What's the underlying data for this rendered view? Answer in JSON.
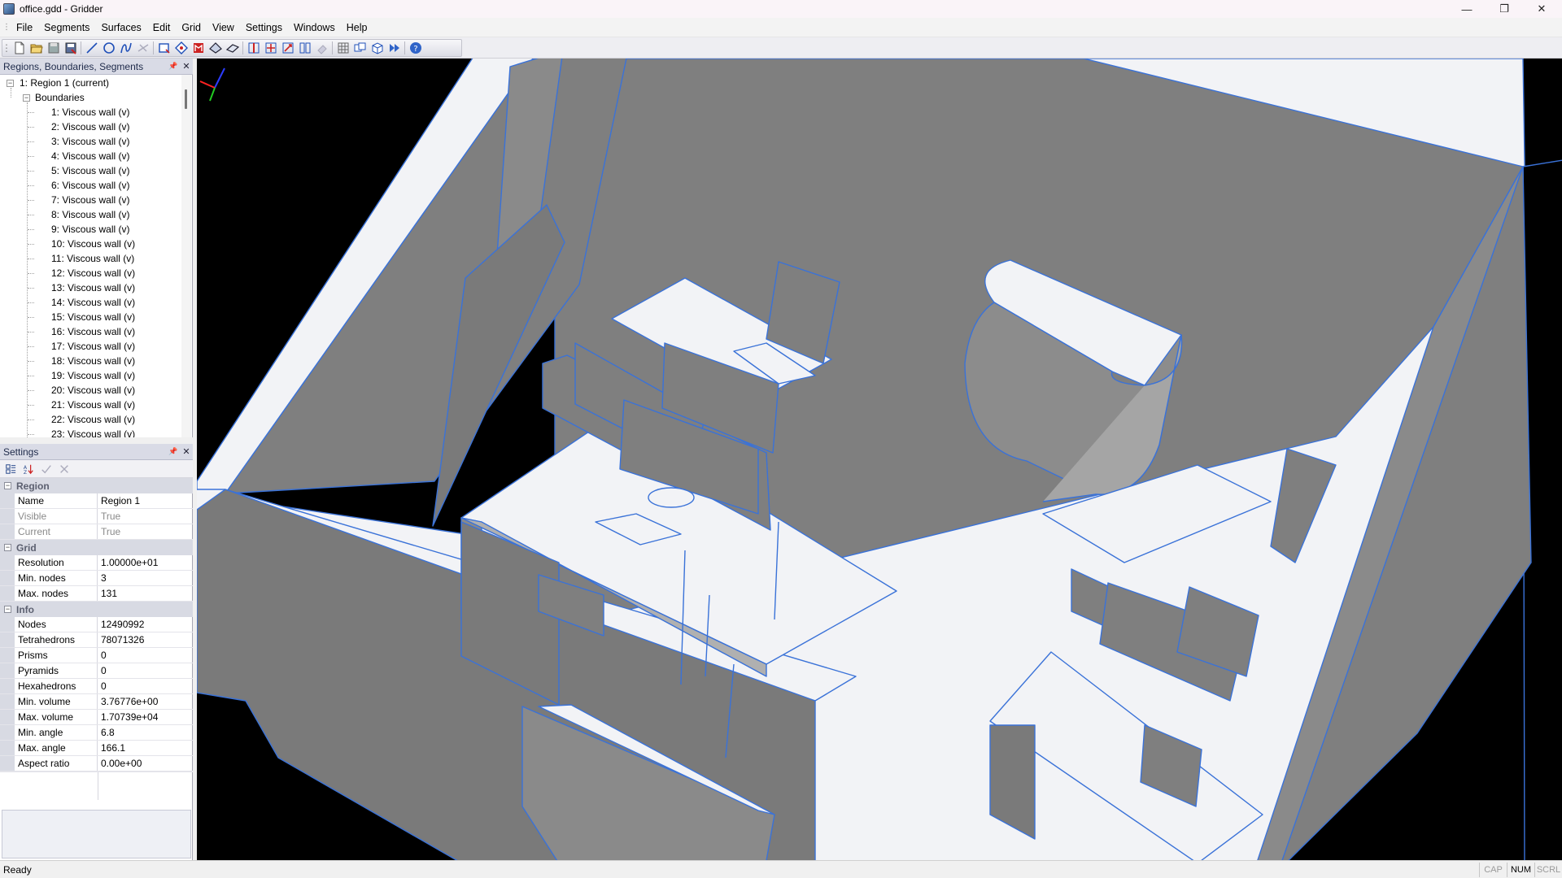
{
  "window": {
    "title": "office.gdd - Gridder",
    "minimize_glyph": "—",
    "restore_glyph": "❐",
    "close_glyph": "✕"
  },
  "menu": [
    "File",
    "Segments",
    "Surfaces",
    "Edit",
    "Grid",
    "View",
    "Settings",
    "Windows",
    "Help"
  ],
  "toolbar": {
    "icons": [
      "new-file-icon",
      "open-folder-icon",
      "save-icon",
      "save-as-icon",
      "line-segment-icon",
      "circle-segment-icon",
      "spline-segment-icon",
      "arc-disabled-icon",
      "create-surface-icon",
      "extrude-surface-icon",
      "revolve-surface-icon",
      "sweep-surface-icon",
      "loft-surface-icon",
      "split-icon",
      "move-icon",
      "scale-icon",
      "mirror-icon",
      "erase-disabled-icon",
      "generate-grid-icon",
      "grid-view-icon",
      "box-view-icon",
      "play-icon",
      "help-icon"
    ]
  },
  "tree_panel": {
    "title": "Regions, Boundaries, Segments",
    "pin_glyph": "📌",
    "close_glyph": "✕",
    "region": "1: Region 1 (current)",
    "boundaries_label": "Boundaries",
    "items": [
      "1: Viscous wall (v)",
      "2: Viscous wall (v)",
      "3: Viscous wall (v)",
      "4: Viscous wall (v)",
      "5: Viscous wall (v)",
      "6: Viscous wall (v)",
      "7: Viscous wall (v)",
      "8: Viscous wall (v)",
      "9: Viscous wall (v)",
      "10: Viscous wall (v)",
      "11: Viscous wall (v)",
      "12: Viscous wall (v)",
      "13: Viscous wall (v)",
      "14: Viscous wall (v)",
      "15: Viscous wall (v)",
      "16: Viscous wall (v)",
      "17: Viscous wall (v)",
      "18: Viscous wall (v)",
      "19: Viscous wall (v)",
      "20: Viscous wall (v)",
      "21: Viscous wall (v)",
      "22: Viscous wall (v)",
      "23: Viscous wall (v)"
    ]
  },
  "settings_panel": {
    "title": "Settings",
    "pin_glyph": "📌",
    "close_glyph": "✕",
    "categories": [
      {
        "name": "Region",
        "rows": [
          {
            "name": "Name",
            "value": "Region 1",
            "dim": false
          },
          {
            "name": "Visible",
            "value": "True",
            "dim": true
          },
          {
            "name": "Current",
            "value": "True",
            "dim": true
          }
        ]
      },
      {
        "name": "Grid",
        "rows": [
          {
            "name": "Resolution",
            "value": "1.00000e+01",
            "dim": false
          },
          {
            "name": "Min. nodes",
            "value": "3",
            "dim": false
          },
          {
            "name": "Max. nodes",
            "value": "131",
            "dim": false
          }
        ]
      },
      {
        "name": "Info",
        "rows": [
          {
            "name": "Nodes",
            "value": "12490992",
            "dim": false
          },
          {
            "name": "Tetrahedrons",
            "value": "78071326",
            "dim": false
          },
          {
            "name": "Prisms",
            "value": "0",
            "dim": false
          },
          {
            "name": "Pyramids",
            "value": "0",
            "dim": false
          },
          {
            "name": "Hexahedrons",
            "value": "0",
            "dim": false
          },
          {
            "name": "Min. volume",
            "value": "3.76776e+00",
            "dim": false
          },
          {
            "name": "Max. volume",
            "value": "1.70739e+04",
            "dim": false
          },
          {
            "name": "Min. angle",
            "value": "6.8",
            "dim": false
          },
          {
            "name": "Max. angle",
            "value": "166.1",
            "dim": false
          },
          {
            "name": "Aspect ratio",
            "value": "0.00e+00",
            "dim": false
          }
        ]
      }
    ]
  },
  "viewport": {
    "background": "#000000",
    "edge_color": "#3a72d8",
    "wall_color": "#7f7f7f",
    "light_color": "#f2f3f6"
  },
  "status": {
    "text": "Ready",
    "indicators": [
      {
        "label": "CAP",
        "on": false
      },
      {
        "label": "NUM",
        "on": true
      },
      {
        "label": "SCRL",
        "on": false
      }
    ]
  }
}
